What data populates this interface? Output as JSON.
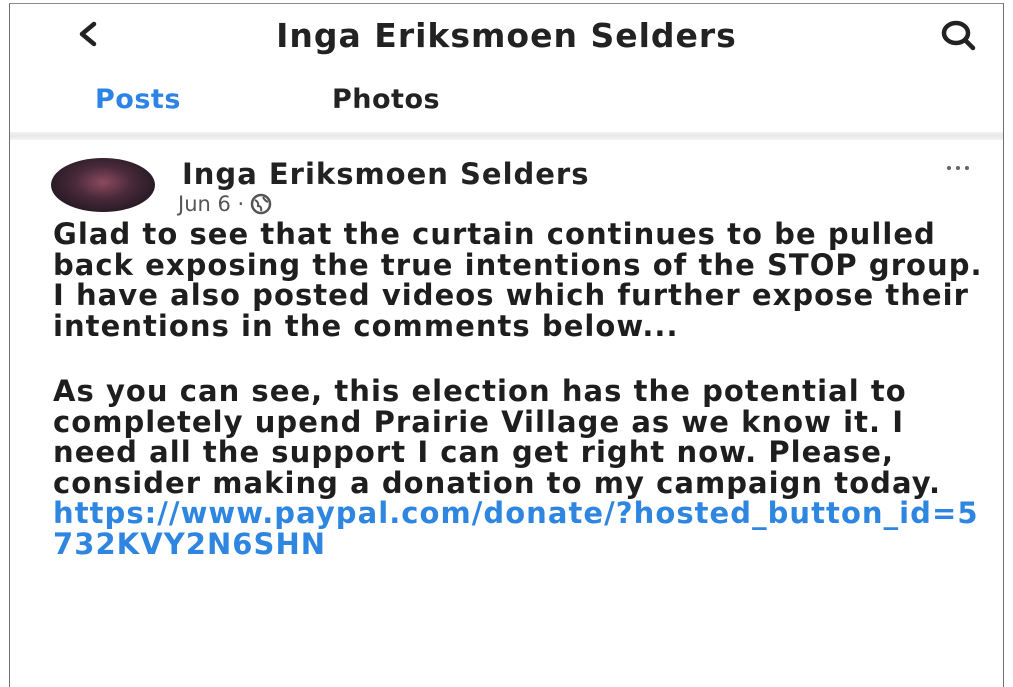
{
  "header": {
    "title": "Inga Eriksmoen Selders",
    "back_icon": "chevron-left-icon",
    "search_icon": "search-icon"
  },
  "tabs": [
    {
      "label": "Posts",
      "active": true
    },
    {
      "label": "Photos",
      "active": false
    }
  ],
  "post": {
    "author": "Inga Eriksmoen Selders",
    "date": "Jun 6 ·",
    "audience_icon": "globe-icon",
    "more_icon": "more-horizontal-icon",
    "paragraph1": "Glad to see that the curtain continues to be pulled back exposing the true intentions of the STOP group. I have also posted videos which further expose their intentions in the comments below...",
    "paragraph2": "As you can see, this election has the potential to completely upend Prairie Village as we know it. I need all the support I can get right now. Please, consider making a donation to my campaign today.",
    "link": "https://www.paypal.com/donate/?hosted_button_id=5732KVY2N6SHN"
  },
  "colors": {
    "accent": "#2d83e6",
    "link": "#2e86e0",
    "text": "#1e1e1e"
  }
}
